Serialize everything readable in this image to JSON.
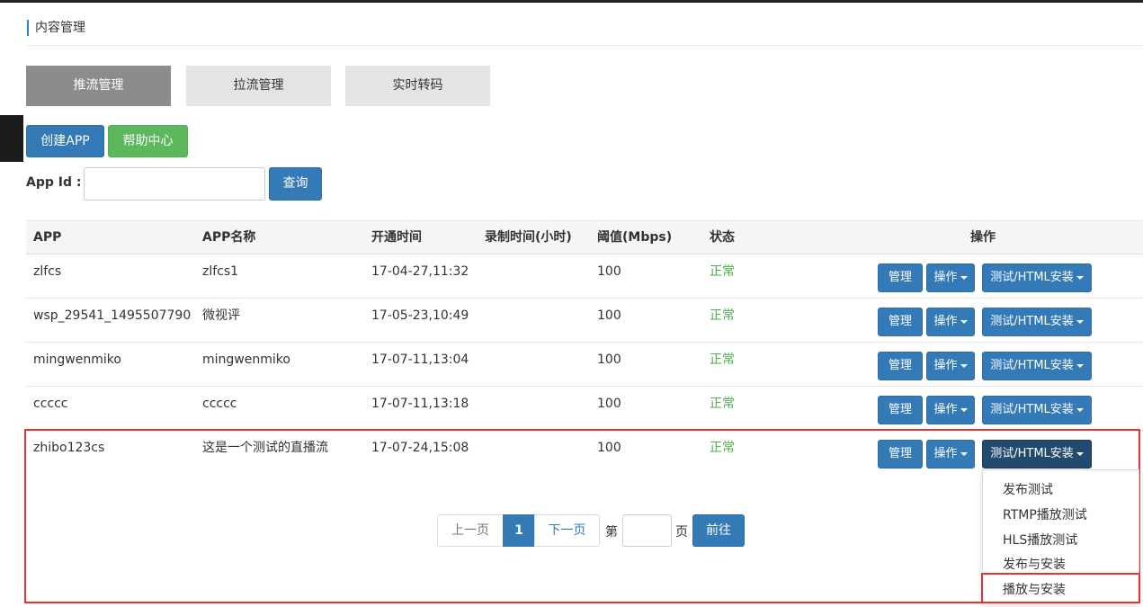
{
  "page_title": "内容管理",
  "tabs": [
    "推流管理",
    "拉流管理",
    "实时转码"
  ],
  "actions": {
    "create_app": "创建APP",
    "help_center": "帮助中心"
  },
  "filter": {
    "label": "App Id :",
    "query_button": "查询",
    "value": ""
  },
  "table": {
    "headers": [
      "APP",
      "APP名称",
      "开通时间",
      "录制时间(小时)",
      "阈值(Mbps)",
      "状态",
      "操作"
    ],
    "rows": [
      {
        "app": "zlfcs",
        "name": "zlfcs1",
        "opened": "17-04-27,11:32",
        "record": "",
        "threshold": "100",
        "status": "正常"
      },
      {
        "app": "wsp_29541_1495507790",
        "name": "微视评",
        "opened": "17-05-23,10:49",
        "record": "",
        "threshold": "100",
        "status": "正常"
      },
      {
        "app": "mingwenmiko",
        "name": "mingwenmiko",
        "opened": "17-07-11,13:04",
        "record": "",
        "threshold": "100",
        "status": "正常"
      },
      {
        "app": "ccccc",
        "name": "ccccc",
        "opened": "17-07-11,13:18",
        "record": "",
        "threshold": "100",
        "status": "正常"
      },
      {
        "app": "zhibo123cs",
        "name": "这是一个测试的直播流",
        "opened": "17-07-24,15:08",
        "record": "",
        "threshold": "100",
        "status": "正常"
      }
    ],
    "row_buttons": {
      "manage": "管理",
      "operate": "操作",
      "test": "测试/HTML安装"
    }
  },
  "pagination": {
    "prev": "上一页",
    "current": "1",
    "next": "下一页",
    "page_prefix": "第",
    "page_suffix": "页",
    "go": "前往",
    "page_input": ""
  },
  "dropdown_menu": [
    "发布测试",
    "RTMP播放测试",
    "HLS播放测试",
    "发布与安装",
    "播放与安装"
  ],
  "colors": {
    "primary": "#337ab7",
    "success": "#5cb85c",
    "status_ok": "#4cae4c",
    "highlight": "#e53333",
    "active_tab": "#8c8c8c"
  }
}
